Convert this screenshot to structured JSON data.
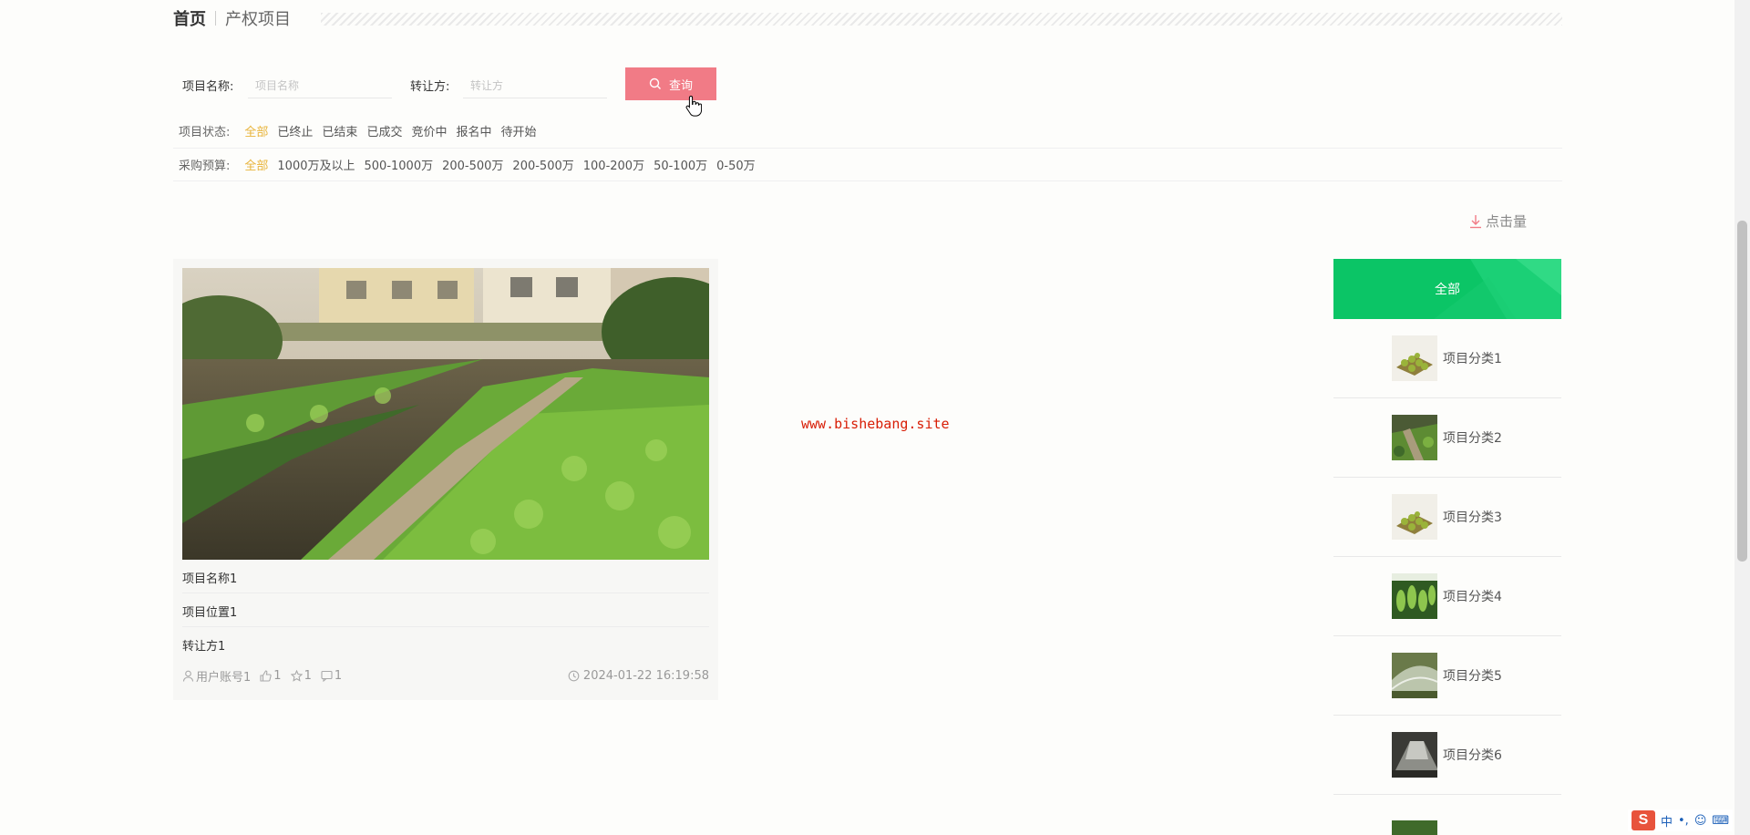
{
  "breadcrumb": {
    "home": "首页",
    "current": "产权项目"
  },
  "search": {
    "name_label": "项目名称:",
    "name_placeholder": "项目名称",
    "transferor_label": "转让方:",
    "transferor_placeholder": "转让方",
    "button_label": "查询"
  },
  "filters": {
    "status": {
      "label": "项目状态:",
      "options": [
        "全部",
        "已终止",
        "已结束",
        "已成交",
        "竞价中",
        "报名中",
        "待开始"
      ],
      "selected": "全部"
    },
    "budget": {
      "label": "采购预算:",
      "options": [
        "全部",
        "1000万及以上",
        "500-1000万",
        "200-500万",
        "200-500万",
        "100-200万",
        "50-100万",
        "0-50万"
      ],
      "selected": "全部"
    }
  },
  "sort": {
    "label": "点击量"
  },
  "card": {
    "name": "项目名称1",
    "location": "项目位置1",
    "transferor": "转让方1",
    "user": "用户账号1",
    "likes": "1",
    "favorites": "1",
    "comments": "1",
    "time": "2024-01-22 16:19:58"
  },
  "watermark": "www.bishebang.site",
  "categories": {
    "header": "全部",
    "items": [
      {
        "name": "项目分类1"
      },
      {
        "name": "项目分类2"
      },
      {
        "name": "项目分类3"
      },
      {
        "name": "项目分类4"
      },
      {
        "name": "项目分类5"
      },
      {
        "name": "项目分类6"
      }
    ]
  },
  "ime": {
    "lang": "中"
  },
  "colors": {
    "accent_pink": "#f17b86",
    "active_filter": "#e8b339",
    "category_green": "#0bc566",
    "watermark_red": "#d81e06"
  }
}
